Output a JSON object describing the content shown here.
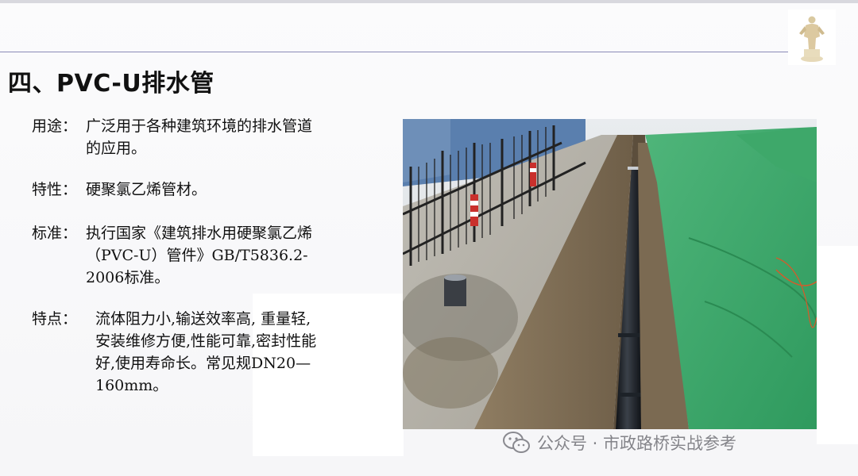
{
  "slide": {
    "title": "四、PVC-U排水管",
    "items": [
      {
        "label": "用途：",
        "lines": [
          "广泛用于各种建筑环境的排水管道",
          "的应用。"
        ]
      },
      {
        "label": "特性：",
        "lines": [
          "硬聚氯乙烯管材。"
        ]
      },
      {
        "label": "标准：",
        "lines": [
          "执行国家《建筑排水用硬聚氯乙烯",
          "（PVC-U）管件》GB/T5836.2-",
          "2006标准。"
        ]
      },
      {
        "label": "特点：",
        "lines": [
          "流体阻力小,输送效率高, 重量轻,",
          "安装维修方便,性能可靠,密封性能",
          "好,使用寿命长。常见规DN20—",
          "160mm。"
        ]
      }
    ]
  },
  "watermark": {
    "text": "公众号 · 市政路桥实战参考",
    "icon": "wechat-icon"
  },
  "colors": {
    "header_line": "#8a8ab8",
    "text": "#111111"
  }
}
